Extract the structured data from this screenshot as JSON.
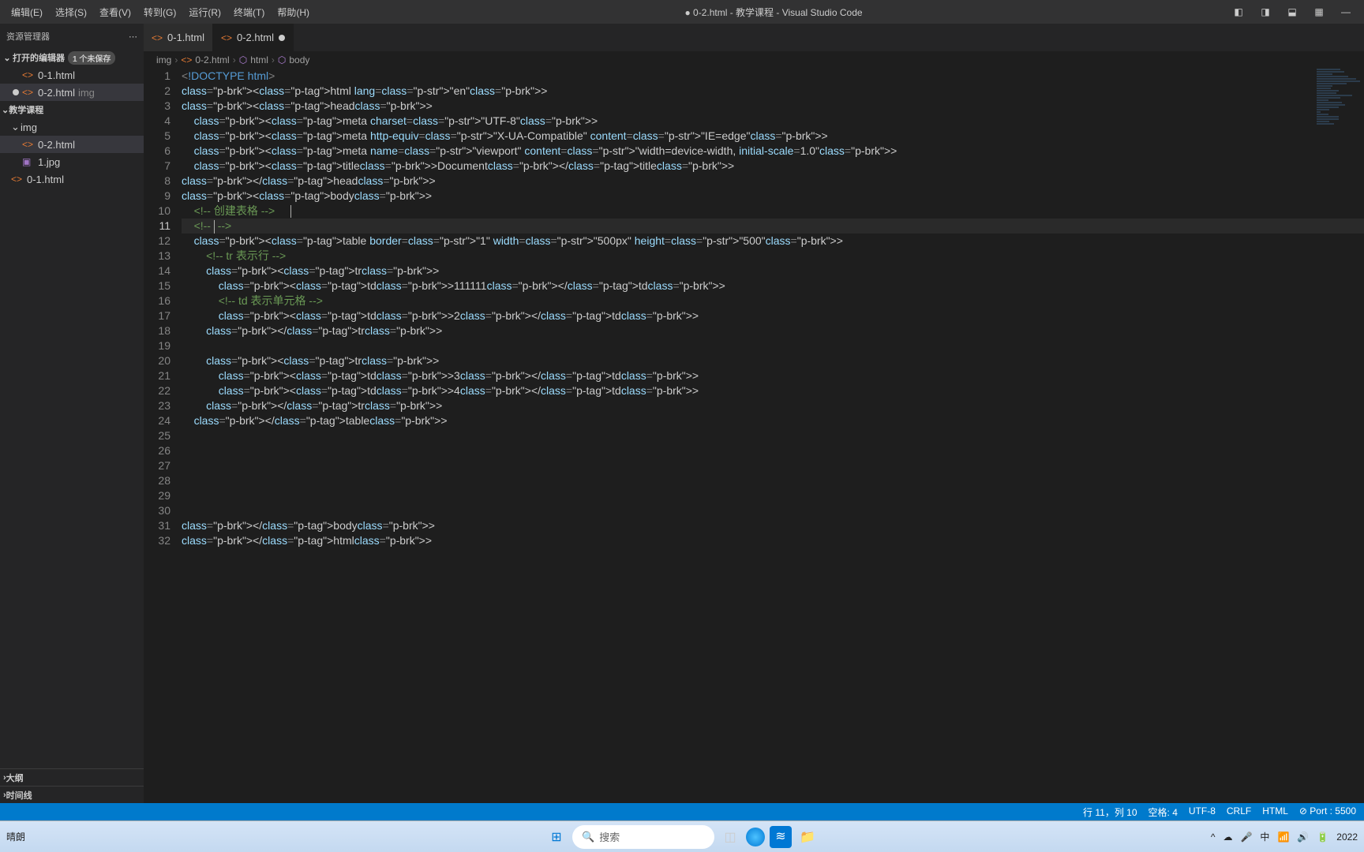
{
  "titlebar": {
    "title": "● 0-2.html - 教学课程 - Visual Studio Code",
    "menu": [
      "编辑(E)",
      "选择(S)",
      "查看(V)",
      "转到(G)",
      "运行(R)",
      "终端(T)",
      "帮助(H)"
    ]
  },
  "sidebar": {
    "title": "资源管理器",
    "open_editors_label": "打开的编辑器",
    "unsaved_badge": "1 个未保存",
    "open_editors": [
      {
        "name": "0-1.html",
        "dirty": false
      },
      {
        "name": "0-2.html",
        "dirty": true,
        "hint": "img",
        "active": true
      }
    ],
    "folder_name": "教学课程",
    "tree": [
      {
        "name": "img",
        "type": "folder",
        "expanded": true
      },
      {
        "name": "0-2.html",
        "type": "file",
        "indent": true,
        "active": true
      },
      {
        "name": "1.jpg",
        "type": "file",
        "indent": true,
        "icon": "img"
      },
      {
        "name": "0-1.html",
        "type": "file"
      }
    ],
    "outline_label": "大纲",
    "timeline_label": "时间线"
  },
  "tabs": [
    {
      "name": "0-1.html",
      "active": false,
      "dirty": false
    },
    {
      "name": "0-2.html",
      "active": true,
      "dirty": true
    }
  ],
  "breadcrumb": [
    {
      "text": "img",
      "type": "folder"
    },
    {
      "text": "0-2.html",
      "type": "file"
    },
    {
      "text": "html",
      "type": "element"
    },
    {
      "text": "body",
      "type": "element"
    }
  ],
  "code": {
    "lines": [
      "<!DOCTYPE html>",
      "<html lang=\"en\">",
      "<head>",
      "    <meta charset=\"UTF-8\">",
      "    <meta http-equiv=\"X-UA-Compatible\" content=\"IE=edge\">",
      "    <meta name=\"viewport\" content=\"width=device-width, initial-scale=1.0\">",
      "    <title>Document</title>",
      "</head>",
      "<body>",
      "    <!-- 创建表格 -->",
      "    <!--  -->",
      "    <table border=\"1\" width=\"500px\" height=\"500\">",
      "        <!-- tr 表示行 -->",
      "        <tr>",
      "            <td>111111</td>",
      "            <!-- td 表示单元格 -->",
      "            <td>2</td>",
      "        </tr>",
      "",
      "        <tr>",
      "            <td>3</td>",
      "            <td>4</td>",
      "        </tr>",
      "    </table>",
      "",
      "",
      "",
      "",
      "",
      "",
      "</body>",
      "</html>"
    ],
    "current_line": 11
  },
  "status": {
    "cursor": "行 11，列 10",
    "spaces": "空格: 4",
    "encoding": "UTF-8",
    "eol": "CRLF",
    "lang": "HTML",
    "port": "Port : 5500"
  },
  "taskbar": {
    "search_placeholder": "搜索",
    "weather": "晴朗",
    "date": "2022"
  }
}
